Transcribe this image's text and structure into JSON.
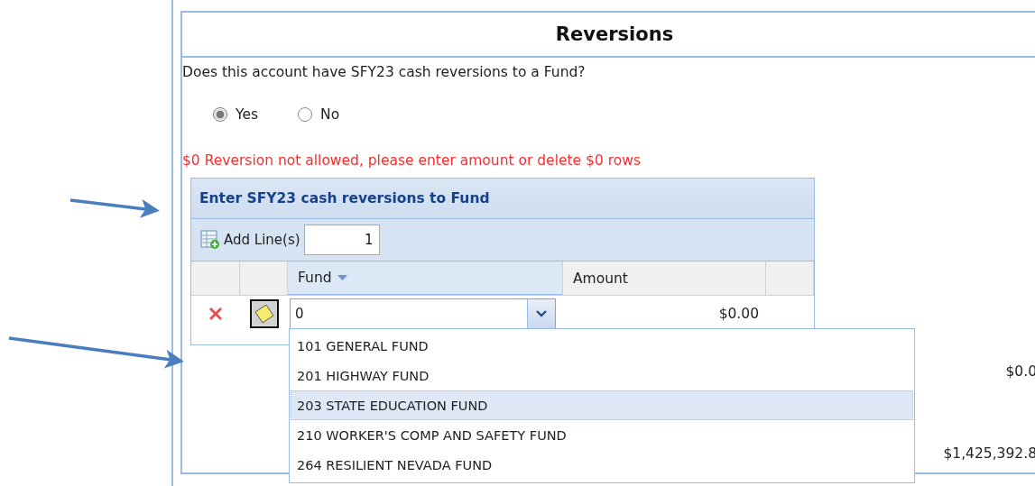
{
  "section": {
    "title": "Reversions"
  },
  "question": {
    "text": "Does this account have SFY23 cash reversions to a Fund?",
    "options": [
      {
        "label": "Yes",
        "selected": true
      },
      {
        "label": "No",
        "selected": false
      }
    ]
  },
  "error_message": "$0 Reversion not allowed, please enter amount or delete $0 rows",
  "grid": {
    "title": "Enter SFY23 cash reversions to Fund",
    "toolbar": {
      "add_label": "Add Line(s)",
      "count": "1"
    },
    "columns": [
      {
        "label": "Fund",
        "active": true
      },
      {
        "label": "Amount",
        "active": false
      }
    ],
    "rows": [
      {
        "fund": "0",
        "amount": "$0.00"
      }
    ]
  },
  "dropdown": {
    "items": [
      {
        "label": "101 GENERAL FUND",
        "selected": false
      },
      {
        "label": "201 HIGHWAY FUND",
        "selected": false
      },
      {
        "label": "203 STATE EDUCATION FUND",
        "selected": true
      },
      {
        "label": "210 WORKER'S COMP AND SAFETY FUND",
        "selected": false
      },
      {
        "label": "264 RESILIENT NEVADA FUND",
        "selected": false
      }
    ]
  },
  "totals": [
    "$0.0",
    "$1,425,392.8"
  ]
}
